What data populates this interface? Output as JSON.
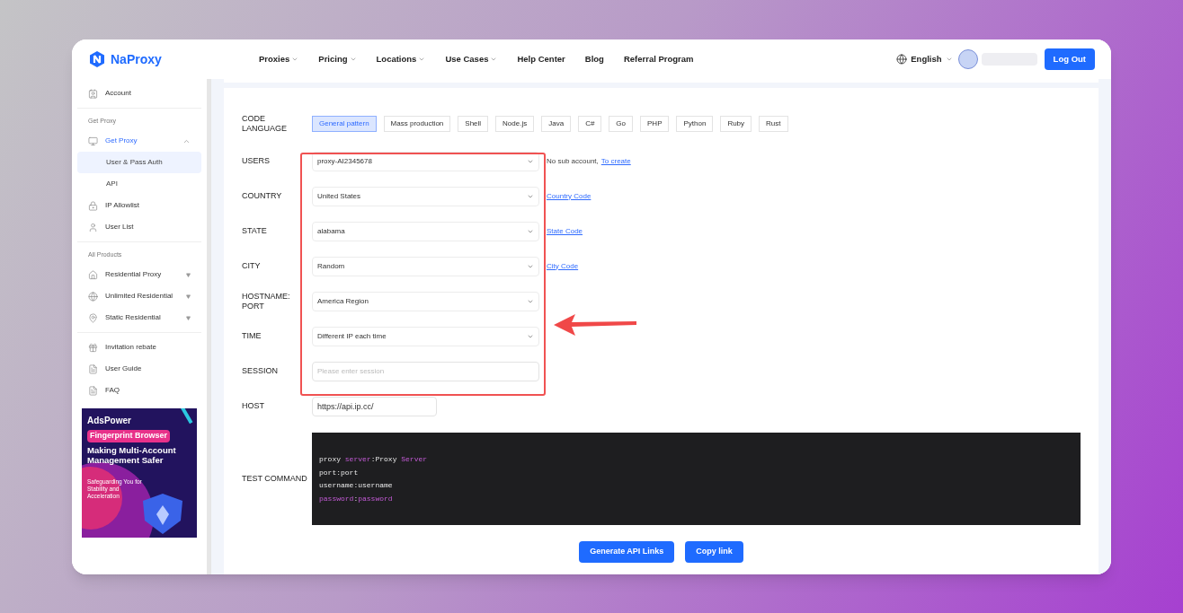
{
  "header": {
    "logo": "NaProxy",
    "nav": [
      {
        "label": "Proxies",
        "dropdown": true
      },
      {
        "label": "Pricing",
        "dropdown": true
      },
      {
        "label": "Locations",
        "dropdown": true
      },
      {
        "label": "Use Cases",
        "dropdown": true
      },
      {
        "label": "Help Center",
        "dropdown": false
      },
      {
        "label": "Blog",
        "dropdown": false
      },
      {
        "label": "Referral Program",
        "dropdown": false
      }
    ],
    "language": "English",
    "logout": "Log Out"
  },
  "sidebar": {
    "groups": [
      {
        "items": [
          {
            "label": "Account",
            "selected": false
          }
        ]
      },
      {
        "title": "Get Proxy",
        "items": [
          {
            "label": "Get Proxy",
            "selected": false,
            "active": true,
            "expanded": true,
            "children": [
              {
                "label": "User & Pass Auth",
                "selected": true
              },
              {
                "label": "API",
                "selected": false
              }
            ]
          },
          {
            "label": "IP Allowlist",
            "selected": false
          },
          {
            "label": "User List",
            "selected": false
          }
        ]
      },
      {
        "title": "All Products",
        "items": [
          {
            "label": "Residential Proxy",
            "selected": false,
            "expanded": false
          },
          {
            "label": "Unlimited Residential",
            "selected": false,
            "expanded": false
          },
          {
            "label": "Static Residential",
            "selected": false,
            "expanded": false
          }
        ]
      },
      {
        "items": [
          {
            "label": "Invitation rebate",
            "selected": false
          },
          {
            "label": "User Guide",
            "selected": false
          },
          {
            "label": "FAQ",
            "selected": false
          }
        ]
      }
    ],
    "banner": {
      "brand": "AdsPower",
      "tag": "Fingerprint Browser",
      "headline": "Making Multi-Account Management Safer",
      "sub": "Safeguarding You for Stability and Acceleration"
    }
  },
  "form": {
    "code_language": {
      "label": "CODE LANGUAGE",
      "options": [
        {
          "label": "General pattern",
          "selected": true
        },
        {
          "label": "Mass production",
          "selected": false
        },
        {
          "label": "Shell",
          "selected": false
        },
        {
          "label": "Node.js",
          "selected": false
        },
        {
          "label": "Java",
          "selected": false
        },
        {
          "label": "C#",
          "selected": false
        },
        {
          "label": "Go",
          "selected": false
        },
        {
          "label": "PHP",
          "selected": false
        },
        {
          "label": "Python",
          "selected": false
        },
        {
          "label": "Ruby",
          "selected": false
        },
        {
          "label": "Rust",
          "selected": false
        }
      ]
    },
    "rows": [
      {
        "label": "USERS",
        "kind": "select",
        "value": "proxy-AI2345678",
        "note": "No sub account,",
        "link": "To create"
      },
      {
        "label": "COUNTRY",
        "kind": "select",
        "value": "United States",
        "link": "Country Code"
      },
      {
        "label": "STATE",
        "kind": "select",
        "value": "alabama",
        "link": "State Code"
      },
      {
        "label": "CITY",
        "kind": "select",
        "value": "Random",
        "link": "City Code"
      },
      {
        "label": "HOSTNAME: PORT",
        "kind": "select",
        "value": "America Region"
      },
      {
        "label": "TIME",
        "kind": "select",
        "value": "Different IP each time"
      },
      {
        "label": "SESSION",
        "kind": "input",
        "placeholder": "Please enter session"
      },
      {
        "label": "HOST",
        "kind": "short_input",
        "value": "https://api.ip.cc/"
      }
    ],
    "test_command": {
      "label": "TEST COMMAND",
      "lines": [
        [
          {
            "text": "proxy ",
            "kind": "plain"
          },
          {
            "text": "server",
            "kind": "key"
          },
          {
            "text": ":Proxy ",
            "kind": "plain"
          },
          {
            "text": "Server",
            "kind": "key"
          }
        ],
        [
          {
            "text": "port:port",
            "kind": "plain"
          }
        ],
        [
          {
            "text": "username:username",
            "kind": "plain"
          }
        ],
        [
          {
            "text": "password",
            "kind": "key"
          },
          {
            "text": ":",
            "kind": "plain"
          },
          {
            "text": "password",
            "kind": "key"
          }
        ]
      ]
    },
    "buttons": [
      "Generate API Links",
      "Copy link"
    ]
  }
}
